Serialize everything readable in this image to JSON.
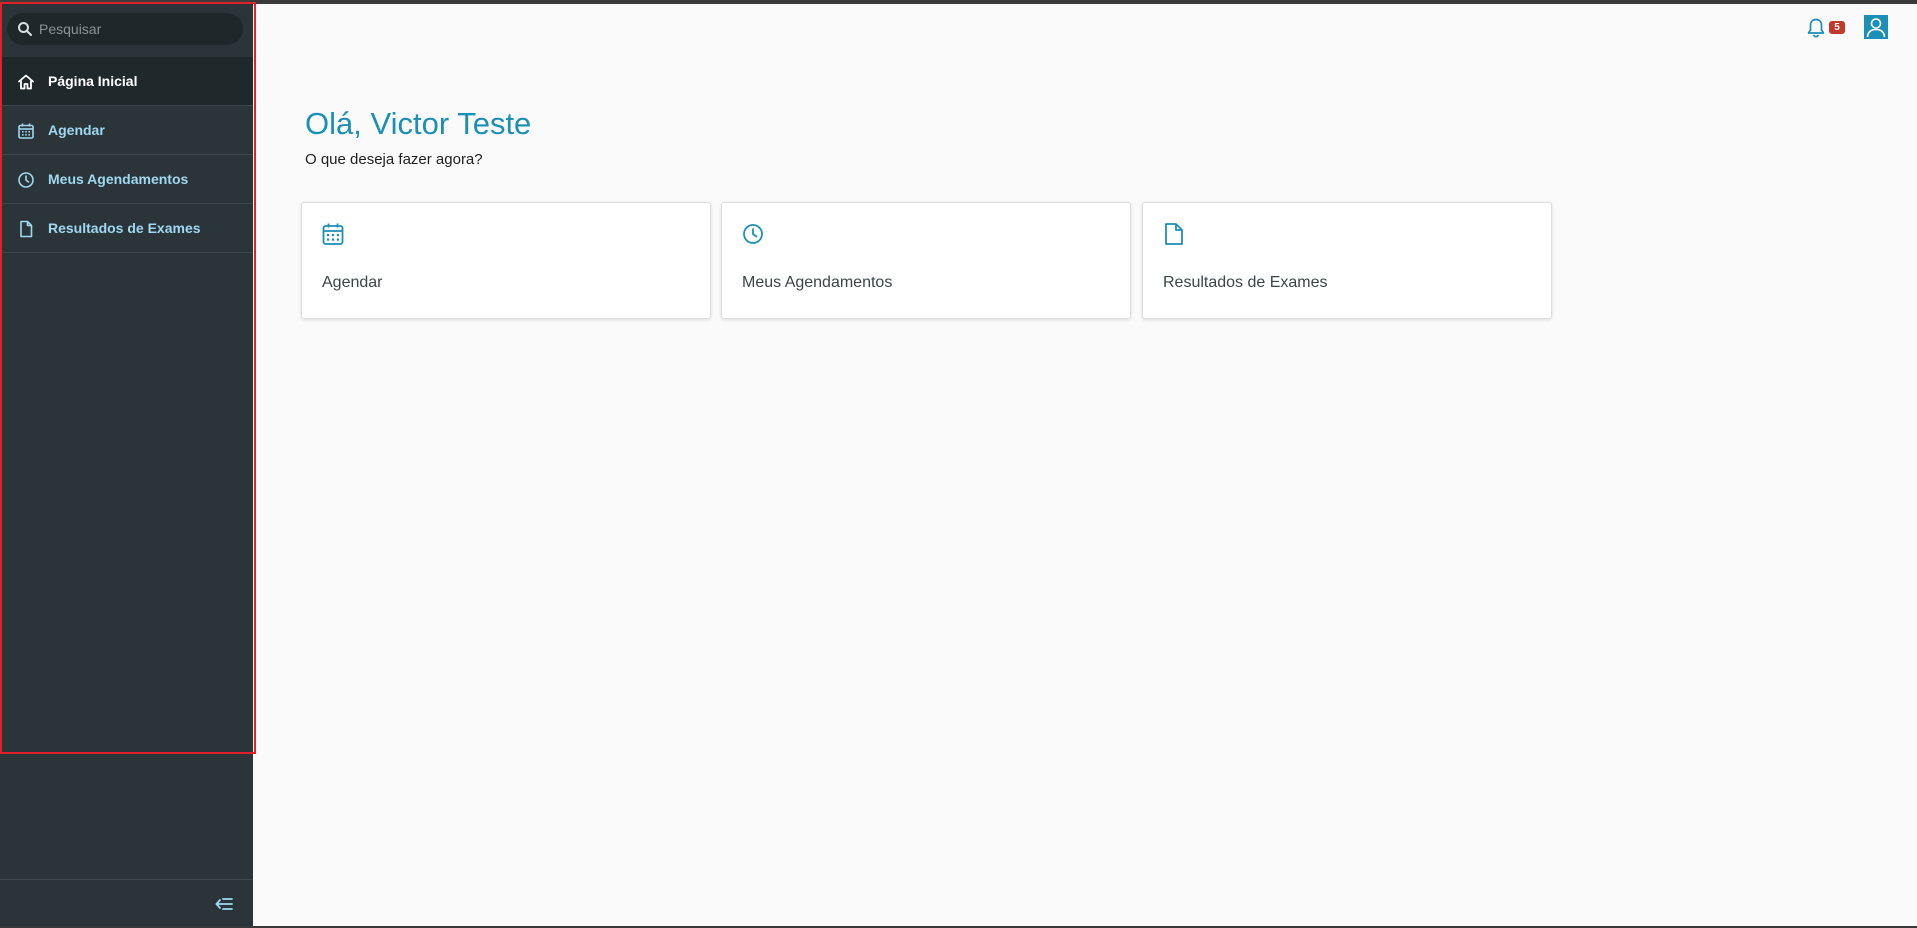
{
  "sidebar": {
    "search": {
      "placeholder": "Pesquisar"
    },
    "items": [
      {
        "label": "Página Inicial",
        "icon": "home-icon",
        "active": true
      },
      {
        "label": "Agendar",
        "icon": "calendar-icon",
        "active": false
      },
      {
        "label": "Meus Agendamentos",
        "icon": "clock-icon",
        "active": false
      },
      {
        "label": "Resultados de Exames",
        "icon": "document-icon",
        "active": false
      }
    ],
    "collapse_icon": "collapse-menu-icon"
  },
  "header": {
    "notifications_count": "5",
    "notification_icon": "bell-icon",
    "user_icon": "user-icon"
  },
  "main": {
    "greeting": "Olá, Victor Teste",
    "subtitle": "O que deseja fazer agora?",
    "cards": [
      {
        "label": "Agendar",
        "icon": "calendar-icon"
      },
      {
        "label": "Meus Agendamentos",
        "icon": "clock-icon"
      },
      {
        "label": "Resultados de Exames",
        "icon": "document-icon"
      }
    ]
  },
  "colors": {
    "sidebar_bg": "#2b3539",
    "sidebar_active_bg": "#1f292b",
    "accent": "#1b8fb5",
    "nav_label": "#9fd8f0",
    "badge": "#c0392b",
    "highlight_border": "#e32028"
  }
}
